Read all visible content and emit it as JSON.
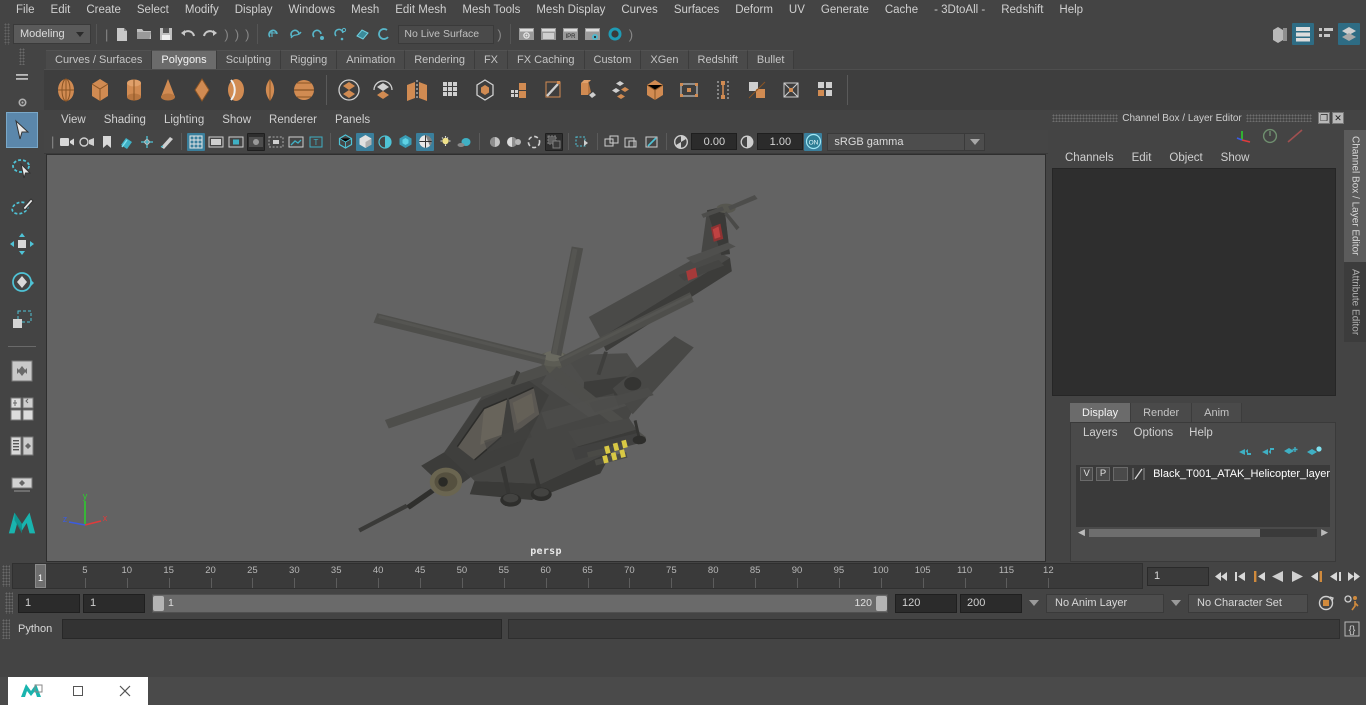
{
  "menubar": {
    "items": [
      "File",
      "Edit",
      "Create",
      "Select",
      "Modify",
      "Display",
      "Windows",
      "Mesh",
      "Edit Mesh",
      "Mesh Tools",
      "Mesh Display",
      "Curves",
      "Surfaces",
      "Deform",
      "UV",
      "Generate",
      "Cache",
      "- 3DtoAll -",
      "Redshift",
      "Help"
    ]
  },
  "statusline": {
    "mode": "Modeling",
    "live_surface": "No Live Surface",
    "icons": [
      "new-scene-icon",
      "open-scene-icon",
      "save-scene-icon",
      "undo-icon",
      "redo-icon",
      "snap-grid-icon",
      "snap-curve-icon",
      "snap-point-icon",
      "snap-projected-center-icon",
      "snap-view-plane-icon",
      "make-live-icon",
      "render-view-icon",
      "render-current-frame-icon",
      "ipr-render-icon",
      "render-settings-icon",
      "hypershade-icon"
    ],
    "right_icons": [
      "show-hide-modeling-toolkit-icon",
      "show-hide-attribute-editor-icon",
      "show-hide-tool-settings-icon",
      "show-hide-channel-box-icon"
    ]
  },
  "shelf": {
    "tabs": [
      "Curves / Surfaces",
      "Polygons",
      "Sculpting",
      "Rigging",
      "Animation",
      "Rendering",
      "FX",
      "FX Caching",
      "Custom",
      "XGen",
      "Redshift",
      "Bullet"
    ],
    "active_tab": "Polygons",
    "icons": [
      "polysphere-icon",
      "polycube-icon",
      "polycylinder-icon",
      "polycone-icon",
      "polytorus-icon",
      "polyplane-icon",
      "polydisc-icon",
      "polyplatonic-icon",
      "combine-icon",
      "separate-icon",
      "mirror-icon",
      "smooth-icon",
      "boolean-icon",
      "reduce-icon",
      "multicut-icon",
      "extrude-icon",
      "bevel-icon",
      "bridge-icon",
      "append-polygon-icon",
      "insert-edge-loop-icon",
      "offset-edge-loop-icon",
      "target-weld-icon",
      "quad-draw-icon"
    ]
  },
  "toolbox": {
    "tools": [
      "select-tool",
      "lasso-select-tool",
      "paint-select-tool",
      "move-tool",
      "rotate-tool",
      "scale-tool",
      "last-tool"
    ],
    "active_tool": "select-tool",
    "layouts": [
      "single-perspective-layout",
      "four-view-layout",
      "outliner-persp-layout",
      "hypergraph-persp-layout"
    ],
    "logo": "maya-logo-icon"
  },
  "viewport": {
    "menus": [
      "View",
      "Shading",
      "Lighting",
      "Show",
      "Renderer",
      "Panels"
    ],
    "camera_label": "persp",
    "exposure": "0.00",
    "gamma": "1.00",
    "color_space": "sRGB gamma",
    "toolbar_icons": [
      "select-camera-icon",
      "camera-attributes-icon",
      "bookmark-icon",
      "image-plane-icon",
      "2d-pan-zoom-icon",
      "grease-pencil-icon",
      "grid-toggle-icon",
      "film-gate-icon",
      "resolution-gate-icon",
      "gate-mask-icon",
      "film-origin-icon",
      "safe-action-icon",
      "text-overlay-icon",
      "wireframe-icon",
      "smooth-shade-icon",
      "shaded-wireframe-icon",
      "hardware-texturing-icon",
      "use-default-lighting-icon",
      "shadows-icon",
      "screen-space-ambient-occlusion-icon",
      "motion-blur-icon",
      "multisample-icon",
      "depth-of-field-icon",
      "isolate-select-icon",
      "xray-icon",
      "xray-joints-icon",
      "xray-active-components-icon",
      "exposure-icon",
      "gamma-icon",
      "color-management-toggle-icon"
    ],
    "axis": {
      "x": "x",
      "y": "y",
      "z": "z"
    },
    "scene_object": "Black_T001_ATAK_Helicopter"
  },
  "channel_box": {
    "panel_title": "Channel Box / Layer Editor",
    "menus": [
      "Channels",
      "Edit",
      "Object",
      "Show"
    ],
    "window_buttons": [
      "restore-icon",
      "close-icon"
    ],
    "header_icons": [
      "channel-box-axis-icon",
      "channel-box-speed-icon",
      "channel-box-graph-icon"
    ]
  },
  "layer_editor": {
    "tabs": [
      "Display",
      "Render",
      "Anim"
    ],
    "active_tab": "Display",
    "menus": [
      "Layers",
      "Options",
      "Help"
    ],
    "buttons": [
      "move-layer-up-icon",
      "move-layer-down-icon",
      "create-new-layer-icon",
      "create-layer-from-selected-icon"
    ],
    "layers": [
      {
        "visibility": "V",
        "playback": "P",
        "state": "",
        "name": "Black_T001_ATAK_Helicopter_layer"
      }
    ]
  },
  "sidetabs": {
    "items": [
      "Channel Box / Layer Editor",
      "Attribute Editor"
    ],
    "active": "Channel Box / Layer Editor"
  },
  "timeline": {
    "tick_labels": [
      "5",
      "10",
      "15",
      "20",
      "25",
      "30",
      "35",
      "40",
      "45",
      "50",
      "55",
      "60",
      "65",
      "70",
      "75",
      "80",
      "85",
      "90",
      "95",
      "100",
      "105",
      "110",
      "115",
      "12"
    ],
    "current_frame_marker": "1",
    "current_frame": "1",
    "transport_icons": [
      "go-to-start-icon",
      "step-back-frame-icon",
      "step-back-key-icon",
      "play-backwards-icon",
      "play-forwards-icon",
      "step-forward-key-icon",
      "step-forward-frame-icon",
      "go-to-end-icon"
    ]
  },
  "range": {
    "anim_start": "1",
    "range_start": "1",
    "bar_start": "1",
    "bar_end": "120",
    "range_end": "120",
    "anim_end": "200",
    "anim_layer": "No Anim Layer",
    "character_set": "No Character Set",
    "right_icons": [
      "auto-key-icon",
      "animation-preferences-icon"
    ]
  },
  "command_line": {
    "language": "Python",
    "input_value": "",
    "output_value": "",
    "script_editor_icon": "script-editor-icon"
  },
  "taskbar": {
    "items": [
      "app-restore-icon",
      "app-maximize-icon",
      "app-close-icon"
    ]
  },
  "colors": {
    "bg": "#444444",
    "panel": "#3e3e3e",
    "accent_teal": "#3a9cbd",
    "accent_orange": "#d98e4a",
    "viewport_bg": "#636363",
    "highlight_blue": "#5b87ab"
  }
}
